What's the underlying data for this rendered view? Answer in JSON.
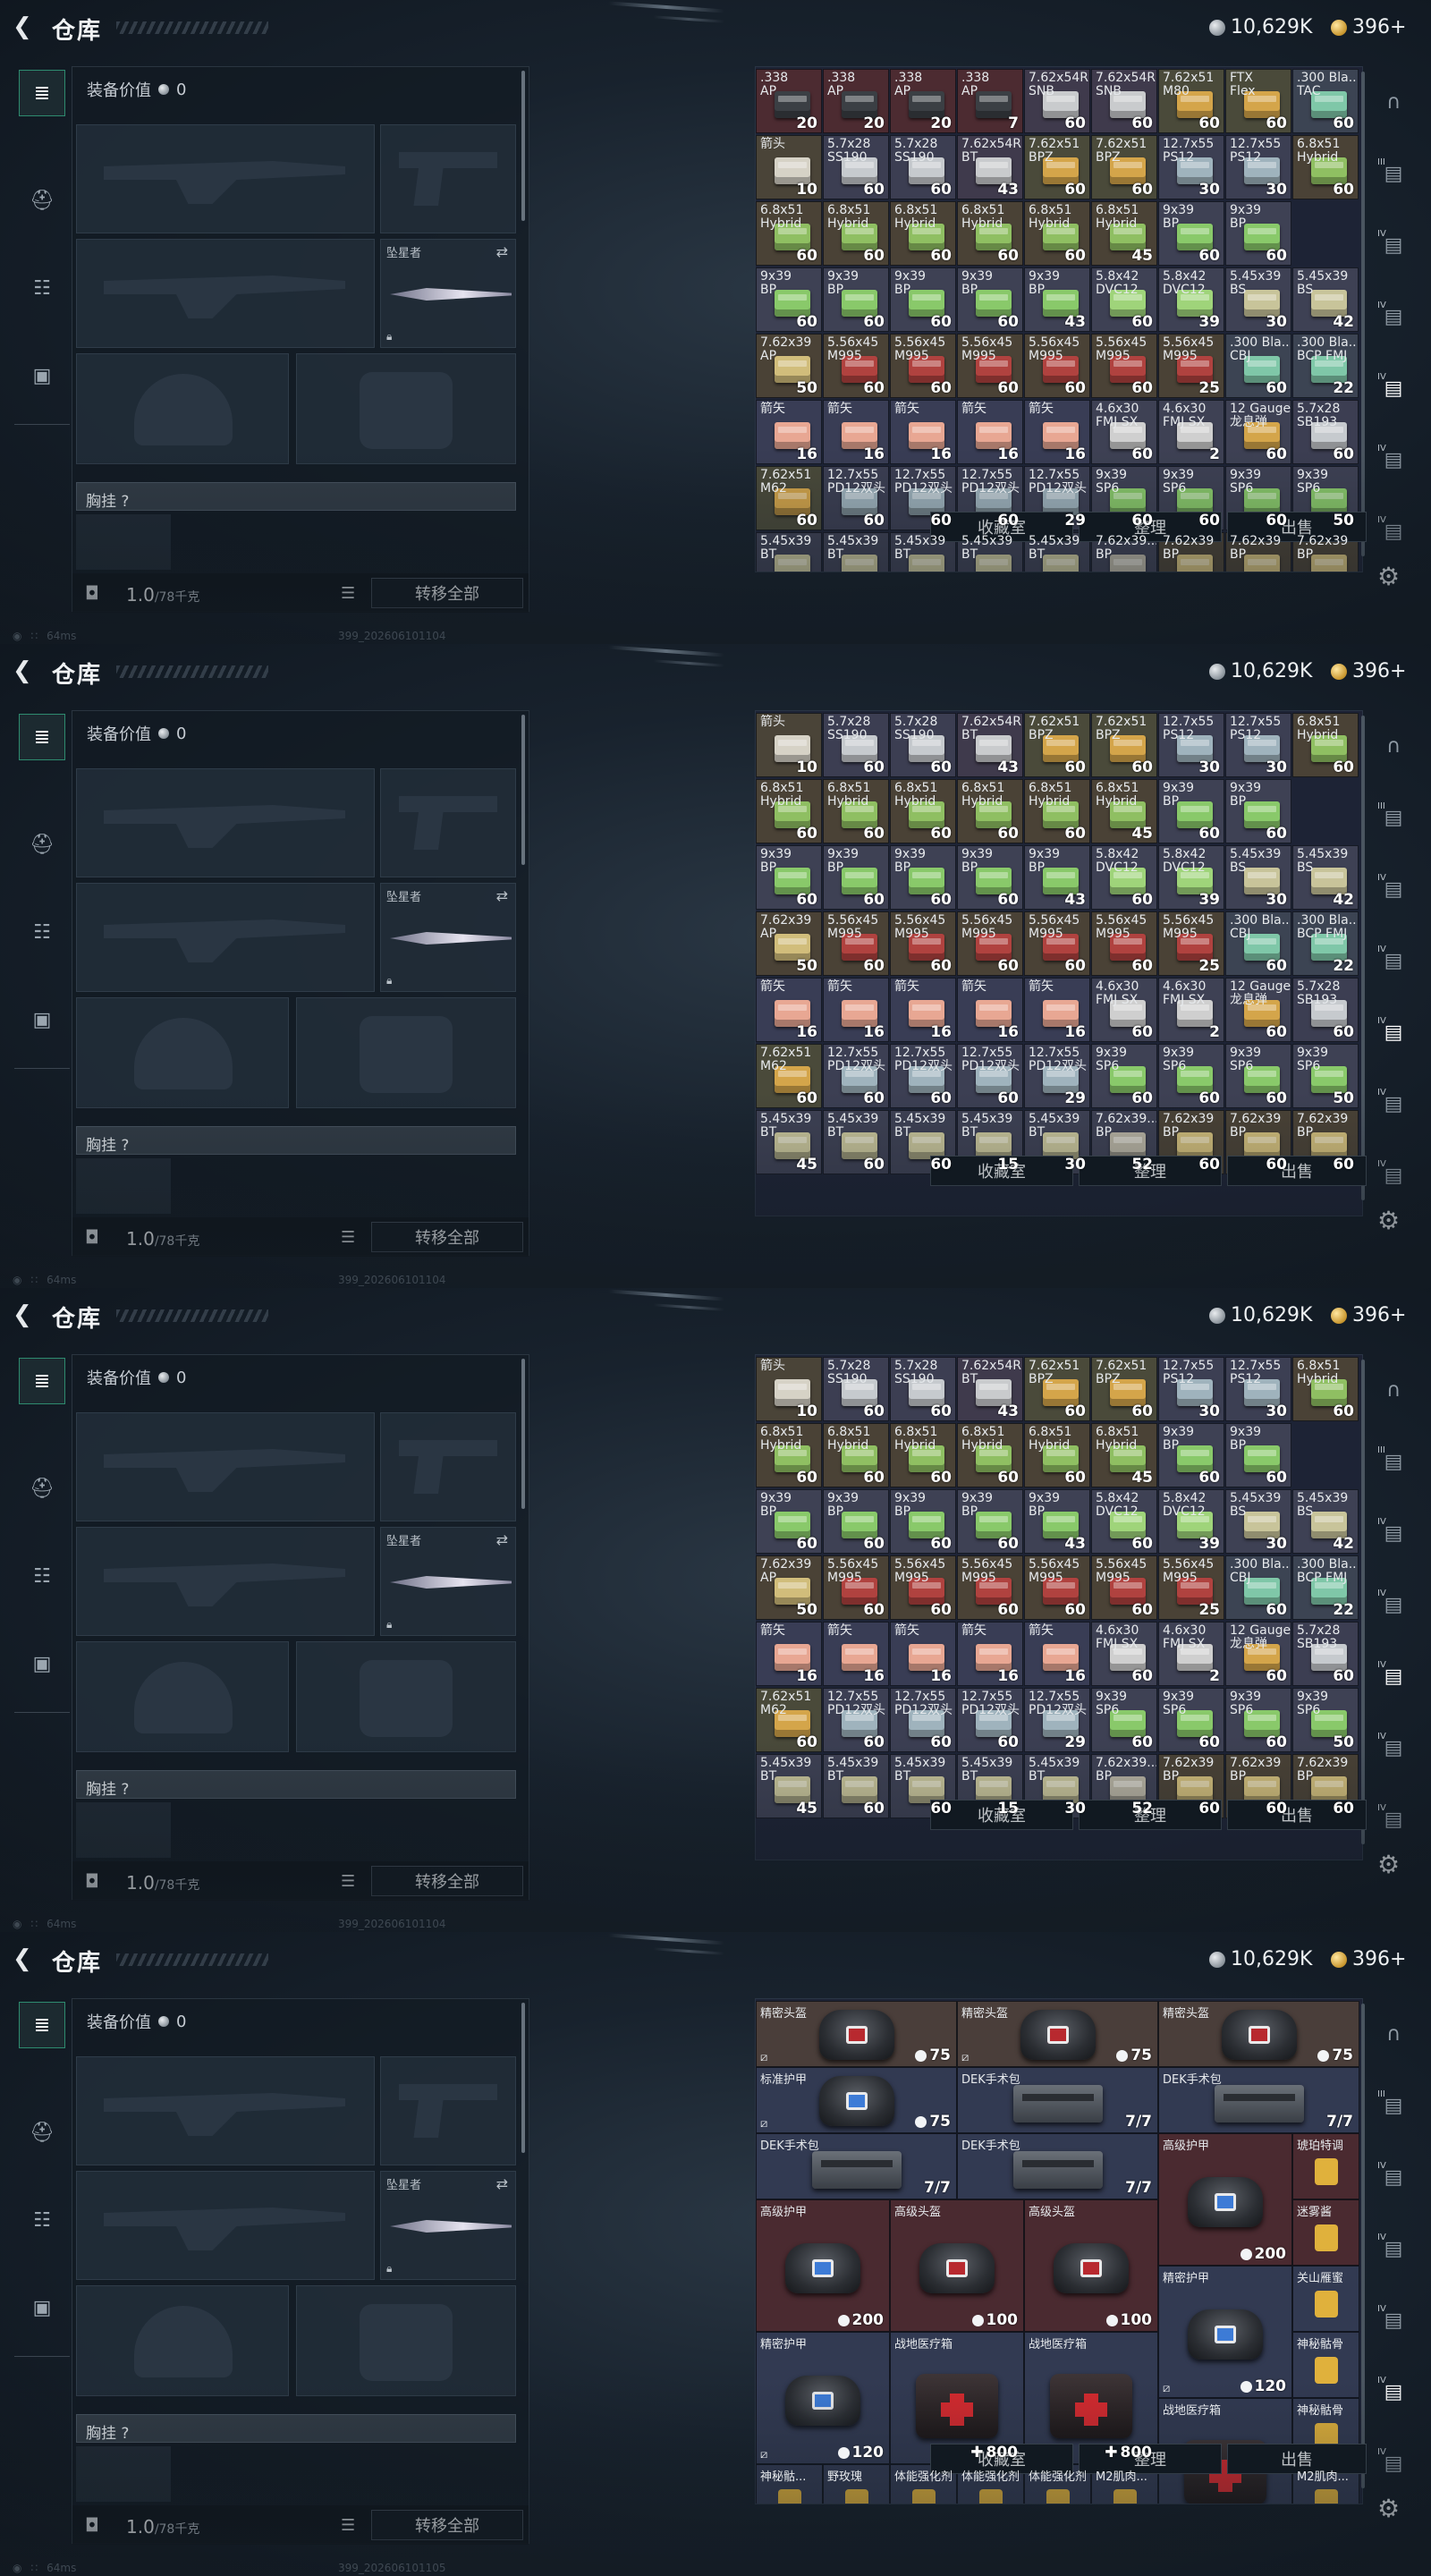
{
  "header": {
    "title": "仓库",
    "currency_silver": "10,629K",
    "currency_gold": "396+"
  },
  "left": {
    "equip_value_label": "装备价值",
    "equip_value": "0",
    "melee_label": "坠星者",
    "vest_label": "胸挂 ?",
    "weight": "1.0",
    "weight_max": "/78千克",
    "transfer_all": "转移全部"
  },
  "right": {
    "collection": "收藏室",
    "sort": "整理",
    "sell": "出售"
  },
  "status": {
    "ping": "64ms",
    "build_1": "399_202606101104",
    "build_4": "399_202606101105"
  },
  "ammo_rows_top": [
    [
      [
        ".338\nAP",
        "20"
      ],
      [
        ".338\nAP",
        "20"
      ],
      [
        ".338\nAP",
        "20"
      ],
      [
        ".338\nAP",
        "7"
      ],
      [
        "7.62x54R\nSNB",
        "60"
      ],
      [
        "7.62x54R\nSNB",
        "60"
      ],
      [
        "7.62x51\nM80",
        "60"
      ],
      [
        "FTX\nFlex",
        "60"
      ],
      [
        ".300 Bla...\nTAC",
        "60"
      ]
    ],
    [
      [
        "箭头\n",
        "10"
      ],
      [
        "5.7x28\nSS190",
        "60"
      ],
      [
        "5.7x28\nSS190",
        "60"
      ],
      [
        "7.62x54R\nBT",
        "43"
      ],
      [
        "7.62x51\nBPZ",
        "60"
      ],
      [
        "7.62x51\nBPZ",
        "60"
      ],
      [
        "12.7x55\nPS12",
        "30"
      ],
      [
        "12.7x55\nPS12",
        "30"
      ],
      [
        "6.8x51\nHybrid",
        "60"
      ]
    ],
    [
      [
        "6.8x51\nHybrid",
        "60"
      ],
      [
        "6.8x51\nHybrid",
        "60"
      ],
      [
        "6.8x51\nHybrid",
        "60"
      ],
      [
        "6.8x51\nHybrid",
        "60"
      ],
      [
        "6.8x51\nHybrid",
        "60"
      ],
      [
        "6.8x51\nHybrid",
        "45"
      ],
      [
        "9x39\nBP",
        "60"
      ],
      [
        "9x39\nBP",
        "60"
      ]
    ],
    [
      [
        "9x39\nBP",
        "60"
      ],
      [
        "9x39\nBP",
        "60"
      ],
      [
        "9x39\nBP",
        "60"
      ],
      [
        "9x39\nBP",
        "60"
      ],
      [
        "9x39\nBP",
        "43"
      ],
      [
        "5.8x42\nDVC12",
        "60"
      ],
      [
        "5.8x42\nDVC12",
        "39"
      ],
      [
        "5.45x39\nBS",
        "30"
      ],
      [
        "5.45x39\nBS",
        "42"
      ]
    ],
    [
      [
        "7.62x39\nAP",
        "50"
      ],
      [
        "5.56x45\nM995",
        "60"
      ],
      [
        "5.56x45\nM995",
        "60"
      ],
      [
        "5.56x45\nM995",
        "60"
      ],
      [
        "5.56x45\nM995",
        "60"
      ],
      [
        "5.56x45\nM995",
        "60"
      ],
      [
        "5.56x45\nM995",
        "25"
      ],
      [
        ".300 Bla...\nCBJ",
        "60"
      ],
      [
        ".300 Bla...\nBCP FMJ",
        "22"
      ]
    ],
    [
      [
        "箭矢\n",
        "16"
      ],
      [
        "箭矢\n",
        "16"
      ],
      [
        "箭矢\n",
        "16"
      ],
      [
        "箭矢\n",
        "16"
      ],
      [
        "箭矢\n",
        "16"
      ],
      [
        "4.6x30\nFMJ SX",
        "60"
      ],
      [
        "4.6x30\nFMJ SX",
        "2"
      ],
      [
        "12 Gauge\n龙息弹",
        "60"
      ],
      [
        "5.7x28\nSB193",
        "60"
      ]
    ],
    [
      [
        "7.62x51\nM62",
        "60"
      ],
      [
        "12.7x55\nPD12双头",
        "60"
      ],
      [
        "12.7x55\nPD12双头",
        "60"
      ],
      [
        "12.7x55\nPD12双头",
        "60"
      ],
      [
        "12.7x55\nPD12双头",
        "29"
      ],
      [
        "9x39\nSP6",
        "60"
      ],
      [
        "9x39\nSP6",
        "60"
      ],
      [
        "9x39\nSP6",
        "60"
      ],
      [
        "9x39\nSP6",
        "50"
      ]
    ],
    [
      [
        "5.45x39\nBT",
        "45"
      ],
      [
        "5.45x39\nBT",
        "60"
      ],
      [
        "5.45x39\nBT",
        "60"
      ],
      [
        "5.45x39\nBT",
        "15"
      ],
      [
        "5.45x39\nBT",
        "30"
      ],
      [
        "7.62x39...\nBP",
        "52"
      ],
      [
        "7.62x39\nBP",
        "60"
      ],
      [
        "7.62x39\nBP",
        "60"
      ],
      [
        "7.62x39\nBP",
        "60"
      ]
    ]
  ],
  "gear": {
    "precision_helmet": "精密头盔",
    "std_armor": "标准护甲",
    "dek_kit": "DEK手术包",
    "adv_armor": "高级护甲",
    "adv_helmet": "高级头盔",
    "precision_armor": "精密护甲",
    "field_medkit": "战地医疗箱",
    "amber_drink": "琥珀特调",
    "mist": "迷雾酱",
    "honey": "关山雁蜜",
    "syringe": "神秘骷骨",
    "m2_syringe": "M2肌肉...",
    "booster": "体能强化剂",
    "wild_rose": "野玫瑰",
    "syringe_short": "神秘骷...",
    "q75": "75",
    "q77": "7/7",
    "q200": "200",
    "q100": "100",
    "q120": "120",
    "q800": "800"
  },
  "colors": {
    "ammo_bg": "#5e4a36",
    "accent_green": "#2e8b6f"
  }
}
